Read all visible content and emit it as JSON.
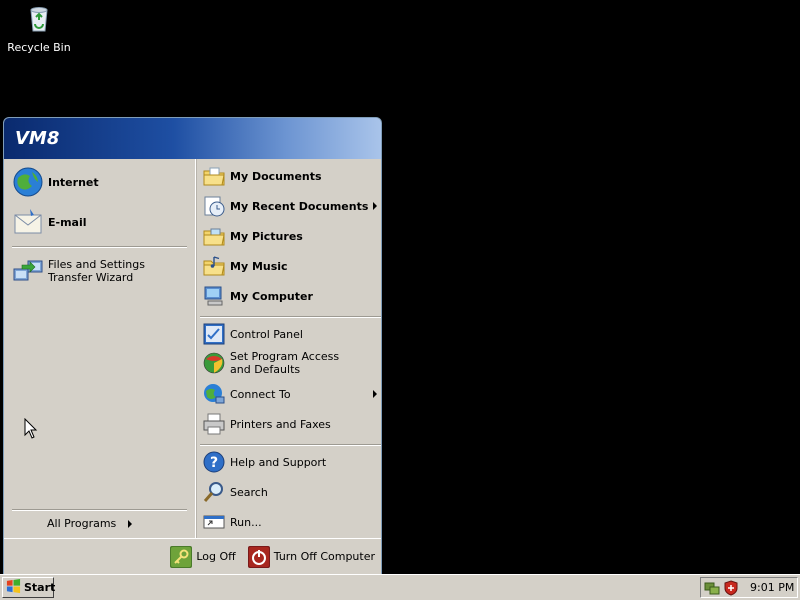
{
  "desktop": {
    "icons": [
      {
        "label": "Recycle Bin",
        "icon": "recycle-bin-icon"
      }
    ]
  },
  "start_menu": {
    "user_name": "VM8",
    "pinned": [
      {
        "label": "Internet",
        "icon": "internet-explorer-icon"
      },
      {
        "label": "E-mail",
        "icon": "email-icon"
      }
    ],
    "recent": [
      {
        "label": "Files and Settings Transfer Wizard",
        "icon": "transfer-wizard-icon"
      }
    ],
    "all_programs": "All Programs",
    "places": [
      {
        "label": "My Documents",
        "icon": "folder-documents-icon"
      },
      {
        "label": "My Recent Documents",
        "icon": "recent-documents-icon",
        "submenu": true
      },
      {
        "label": "My Pictures",
        "icon": "folder-pictures-icon"
      },
      {
        "label": "My Music",
        "icon": "folder-music-icon"
      },
      {
        "label": "My Computer",
        "icon": "computer-icon"
      }
    ],
    "system": [
      {
        "label": "Control Panel",
        "icon": "control-panel-icon"
      },
      {
        "label": "Set Program Access and Defaults",
        "icon": "program-access-icon"
      },
      {
        "label": "Connect To",
        "icon": "connect-to-icon",
        "submenu": true
      },
      {
        "label": "Printers and Faxes",
        "icon": "printer-icon"
      }
    ],
    "help": [
      {
        "label": "Help and Support",
        "icon": "help-icon"
      },
      {
        "label": "Search",
        "icon": "search-icon"
      },
      {
        "label": "Run...",
        "icon": "run-icon"
      }
    ],
    "footer": {
      "log_off": "Log Off",
      "turn_off": "Turn Off Computer"
    }
  },
  "taskbar": {
    "start_label": "Start",
    "clock": "9:01 PM"
  },
  "colors": {
    "desktop_bg": "#000000",
    "menu_bg": "#d4d0c8",
    "header_dark": "#0a2a6e",
    "header_light": "#a9c4ea"
  }
}
